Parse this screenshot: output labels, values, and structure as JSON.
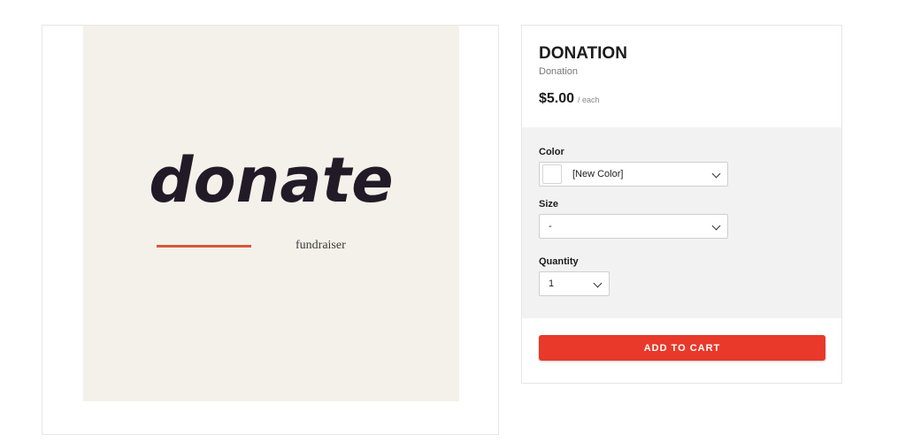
{
  "image": {
    "headline": "donate",
    "tagline": "fundraiser",
    "colors": {
      "background": "#f4f1ea",
      "headline": "#231a28",
      "accent_line": "#d9583a"
    }
  },
  "product": {
    "title": "DONATION",
    "subtitle": "Donation",
    "price": "$5.00",
    "price_unit": "/ each"
  },
  "options": {
    "color": {
      "label": "Color",
      "value": "[New Color]",
      "swatch_icon": "color-swatch-icon"
    },
    "size": {
      "label": "Size",
      "value": "-"
    },
    "quantity": {
      "label": "Quantity",
      "value": "1"
    }
  },
  "cart": {
    "button_label": "ADD TO CART",
    "color": "#e8392a"
  }
}
